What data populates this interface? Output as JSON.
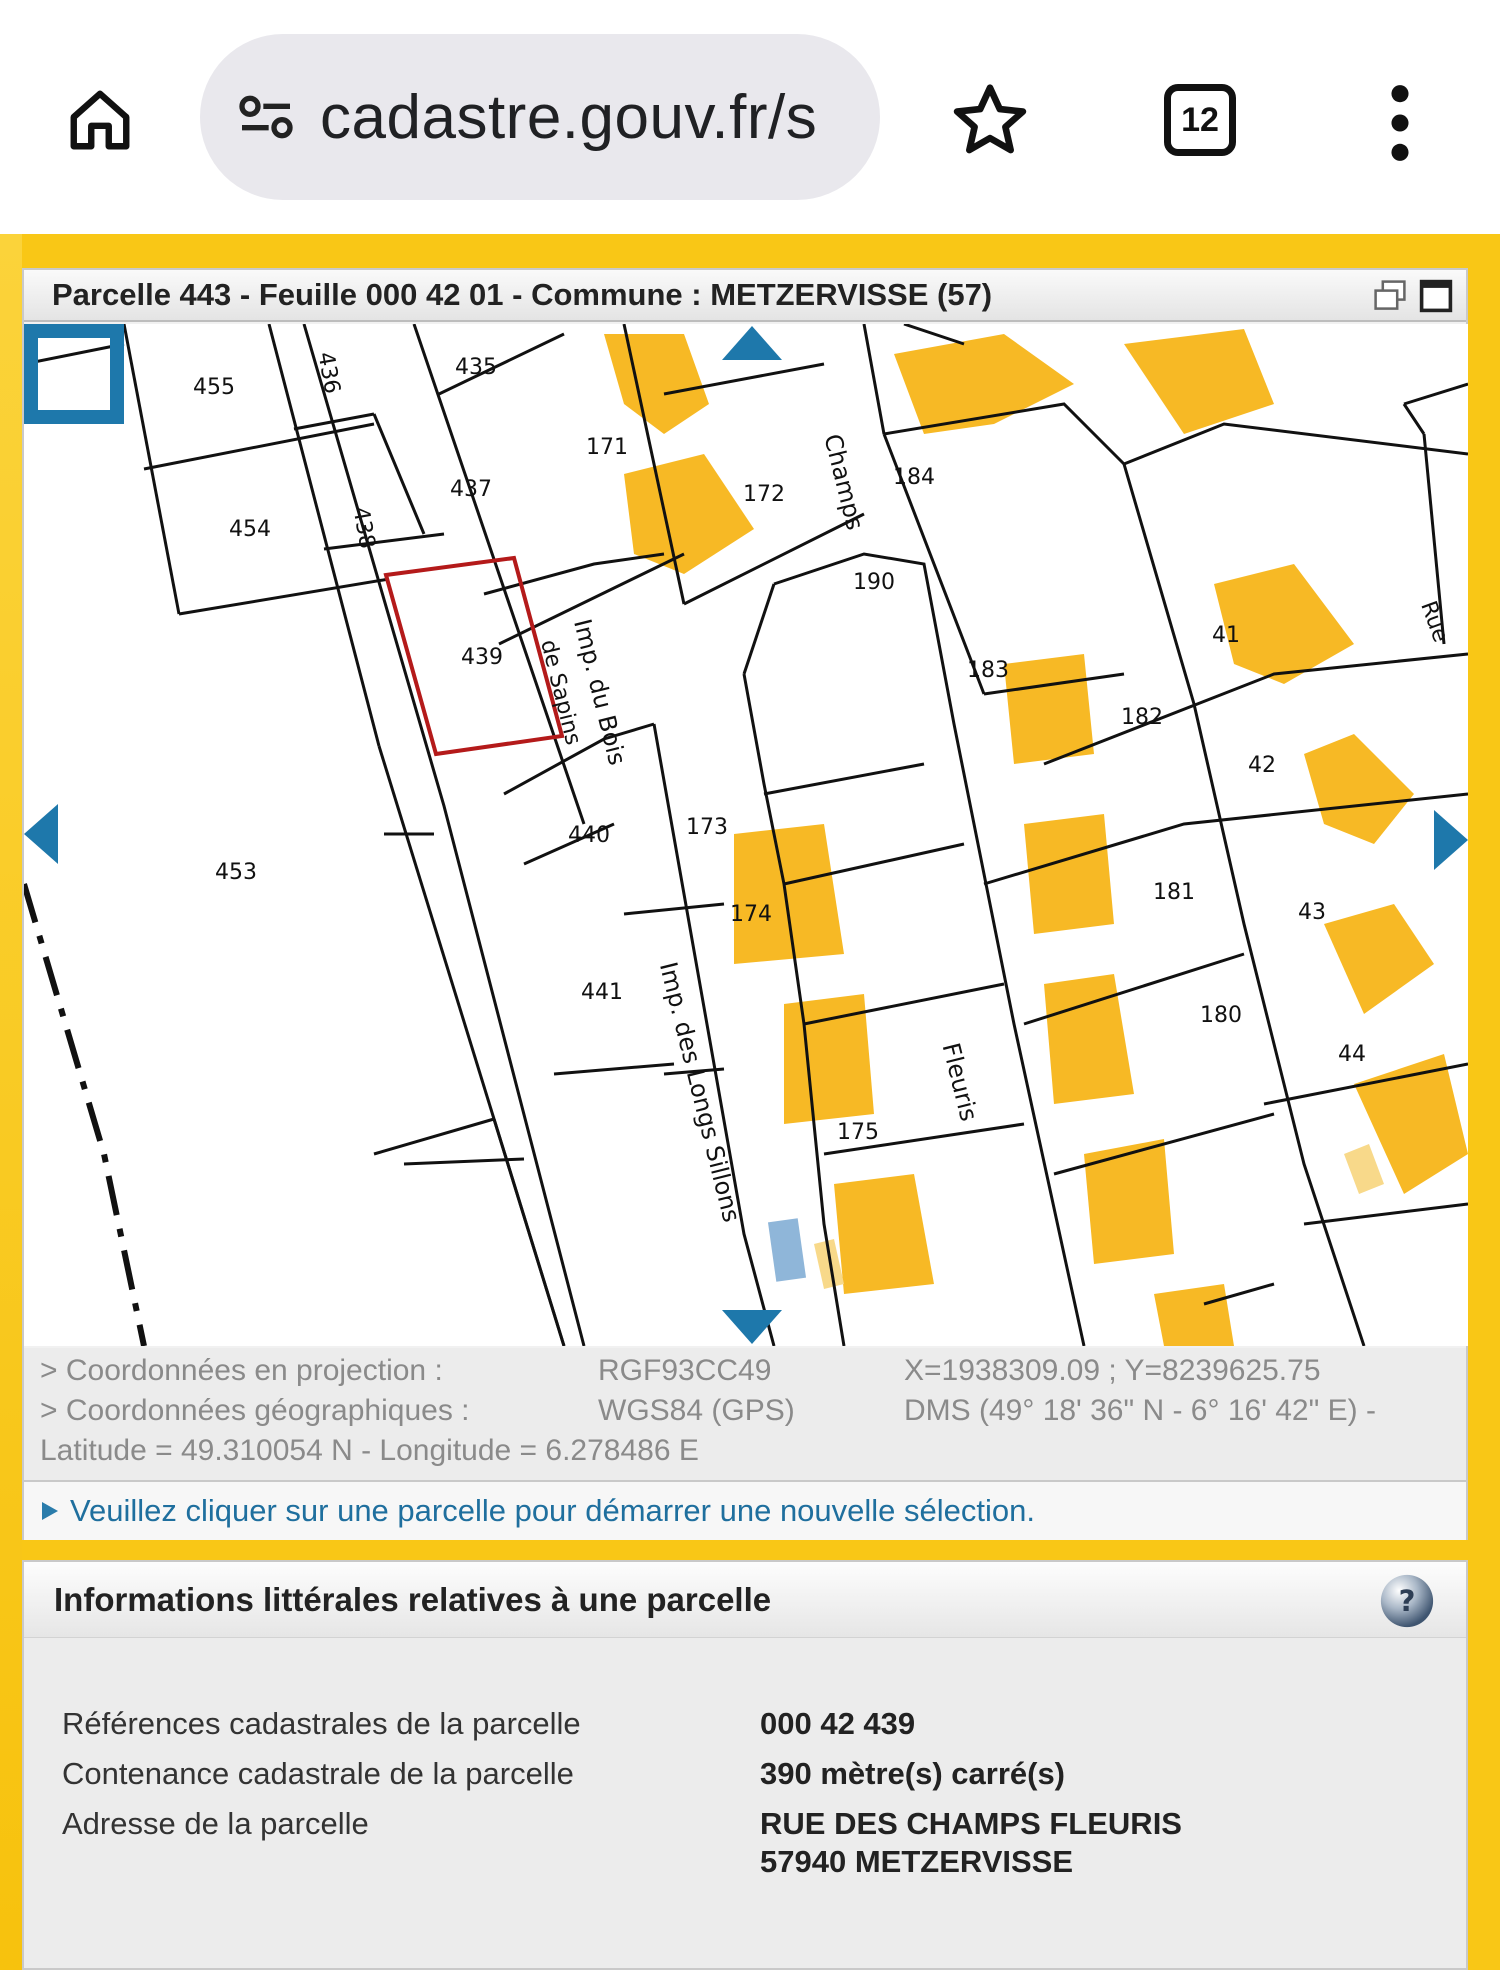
{
  "browser": {
    "url": "cadastre.gouv.fr/s",
    "tab_count": "12",
    "icons": [
      "home-icon",
      "site-settings-icon",
      "star-icon",
      "tabs-icon",
      "more-vert-icon"
    ]
  },
  "map": {
    "title": "Parcelle 443 - Feuille 000 42 01 - Commune : METZERVISSE (57)",
    "parcels": [
      "455",
      "436",
      "435",
      "454",
      "437",
      "438",
      "171",
      "172",
      "184",
      "190",
      "439",
      "41",
      "183",
      "182",
      "42",
      "453",
      "440",
      "173",
      "43",
      "181",
      "174",
      "441",
      "180",
      "44",
      "175"
    ],
    "streets": [
      "Champs",
      "Imp. du Bois",
      "de Sapins",
      "Imp. des Longs Sillons",
      "Fleuris",
      "Rue"
    ],
    "colors": {
      "building": "#f7b925",
      "selection": "#b41a1a",
      "nav": "#1e78ab",
      "water": "#8fb6d9"
    }
  },
  "coords": {
    "proj_label": "> Coordonnées en projection :",
    "proj_system": "RGF93CC49",
    "proj_value": "X=1938309.09 ; Y=8239625.75",
    "geo_label": "> Coordonnées géographiques :",
    "geo_system": "WGS84 (GPS)",
    "geo_value": "DMS (49° 18' 36\" N - 6° 16' 42\" E) -",
    "latlon": "Latitude = 49.310054 N - Longitude = 6.278486 E"
  },
  "message": "Veuillez cliquer sur une parcelle pour démarrer une nouvelle sélection.",
  "info": {
    "title": "Informations littérales relatives à une parcelle",
    "rows": [
      {
        "label": "Références cadastrales de la parcelle",
        "value": "000 42 439"
      },
      {
        "label": "Contenance cadastrale de la parcelle",
        "value": "390 mètre(s) carré(s)"
      },
      {
        "label": "Adresse de la parcelle",
        "value": "RUE DES CHAMPS FLEURIS",
        "value2": "57940 METZERVISSE"
      }
    ]
  }
}
